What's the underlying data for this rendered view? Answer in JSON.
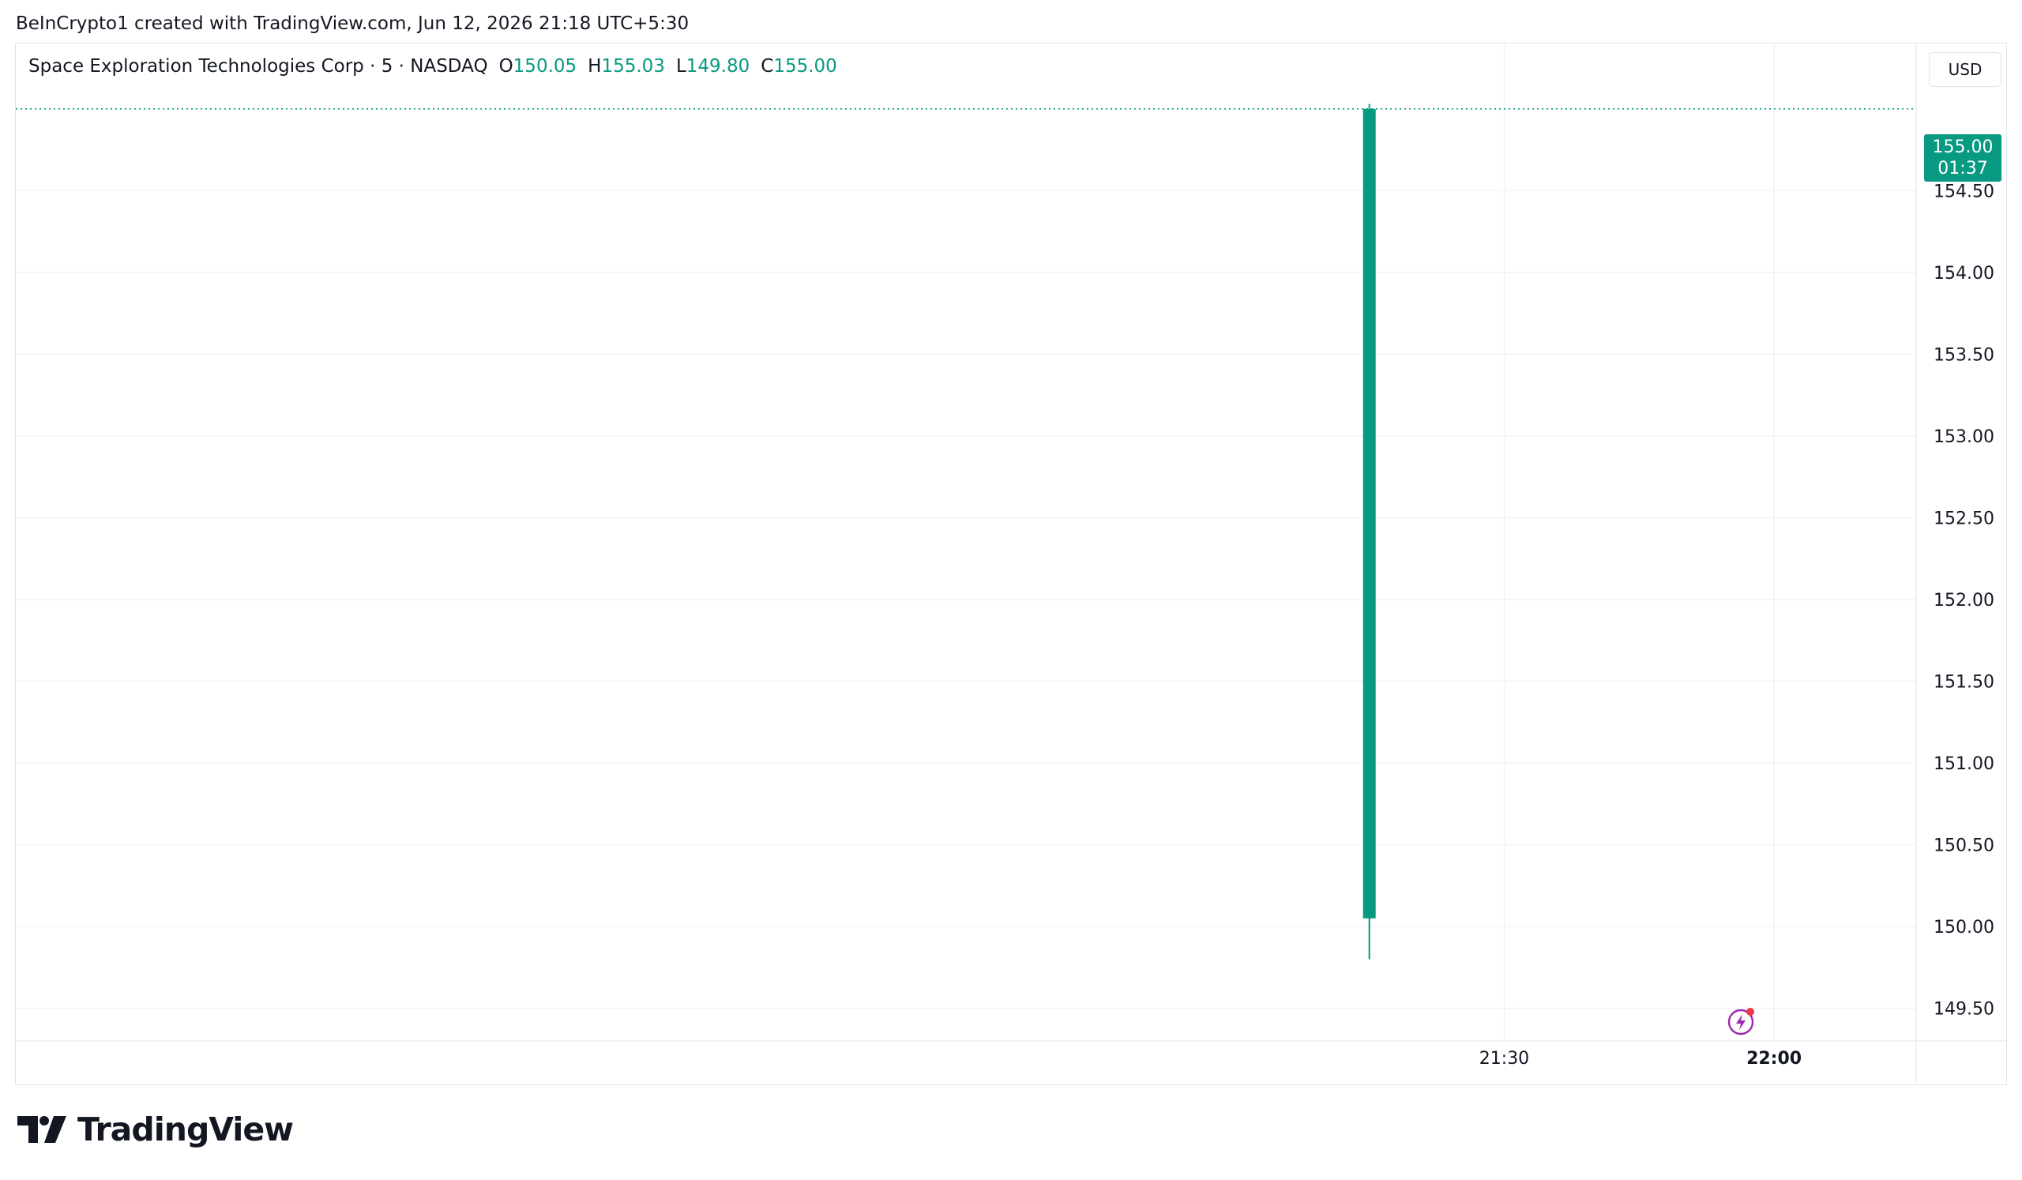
{
  "credit": "BeInCrypto1 created with TradingView.com, Jun 12, 2026 21:18 UTC+5:30",
  "legend": {
    "symbol": "Space Exploration Technologies Corp · 5 · NASDAQ",
    "open_label": "O",
    "open": "150.05",
    "high_label": "H",
    "high": "155.03",
    "low_label": "L",
    "low": "149.80",
    "close_label": "C",
    "close": "155.00"
  },
  "currency": "USD",
  "last_price": {
    "price": "155.00",
    "countdown": "01:37"
  },
  "brand": "TradingView",
  "colors": {
    "up": "#089981",
    "grid": "#f0f3fa",
    "text": "#131722",
    "border": "#e0e3eb",
    "alert_icon": "#9c27b0",
    "alert_dot": "#f23645"
  },
  "icons": {
    "alert": "lightning-bolt-icon",
    "logo": "tradingview-logo-icon"
  },
  "chart_data": {
    "type": "candlestick",
    "title": "Space Exploration Technologies Corp · 5 · NASDAQ",
    "interval": "5",
    "currency": "USD",
    "y_ticks": [
      149.5,
      150.0,
      150.5,
      151.0,
      151.5,
      152.0,
      152.5,
      153.0,
      153.5,
      154.0,
      154.5
    ],
    "y_tick_labels": [
      "149.50",
      "150.00",
      "150.50",
      "151.00",
      "151.50",
      "152.00",
      "152.50",
      "153.00",
      "153.50",
      "154.00",
      "154.50"
    ],
    "ylim": [
      149.3,
      155.4
    ],
    "x_ticks": [
      {
        "label": "21:30",
        "minutes": 1290,
        "bold": false
      },
      {
        "label": "22:00",
        "minutes": 1320,
        "bold": true
      }
    ],
    "xlim": [
      1124.5,
      1335.8
    ],
    "candles": [
      {
        "time": "21:15",
        "minutes": 1275,
        "open": 150.05,
        "high": 155.03,
        "low": 149.8,
        "close": 155.0
      }
    ],
    "last_price": 155.0,
    "grid": true
  }
}
